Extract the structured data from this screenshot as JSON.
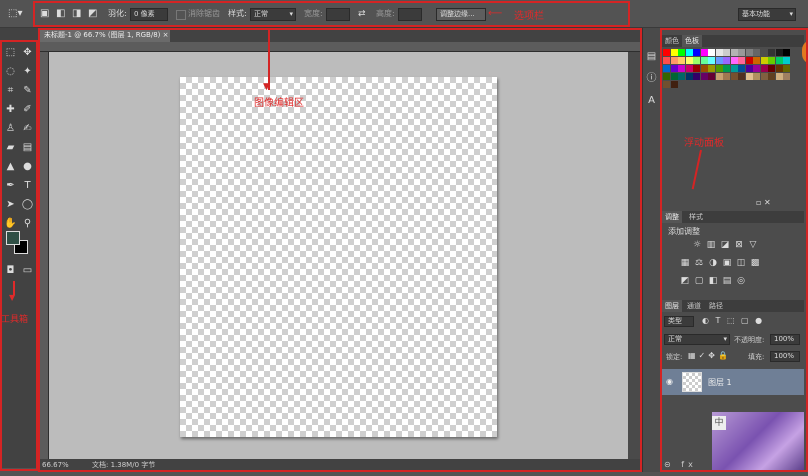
{
  "options_bar": {
    "feather_label": "羽化:",
    "feather_value": "0 像素",
    "antialias_label": "消除锯齿",
    "style_label": "样式:",
    "style_value": "正常",
    "width_label": "宽度:",
    "height_label": "高度:",
    "refine_edge_label": "调整边缘...",
    "workspace_value": "基本功能"
  },
  "document": {
    "tab_title": "未标题-1 @ 66.7% (图层 1, RGB/8) ×",
    "zoom": "66.67%",
    "doc_info": "文档: 1.38M/0 字节"
  },
  "annotations": {
    "canvas": "图像编辑区",
    "options": "选项栏",
    "panels": "浮动面板",
    "tools": "工具箱"
  },
  "swatches_panel": {
    "tabs": [
      "颜色",
      "色板"
    ],
    "colors": [
      "#ff0000",
      "#ffff00",
      "#00ff00",
      "#00ffff",
      "#0000ff",
      "#ff00ff",
      "#ffffff",
      "#e6e6e6",
      "#cccccc",
      "#b3b3b3",
      "#999999",
      "#808080",
      "#666666",
      "#4d4d4d",
      "#333333",
      "#1a1a1a",
      "#000000",
      "#ff4d4d",
      "#ff9966",
      "#ffcc66",
      "#ffff66",
      "#99ff66",
      "#66ff99",
      "#66ffff",
      "#6699ff",
      "#9966ff",
      "#ff66ff",
      "#ff6699",
      "#cc0000",
      "#cc6600",
      "#cccc00",
      "#66cc00",
      "#00cc66",
      "#00cccc",
      "#0066cc",
      "#6600cc",
      "#cc00cc",
      "#cc0066",
      "#990000",
      "#994d00",
      "#999900",
      "#4d9900",
      "#00994d",
      "#009999",
      "#004d99",
      "#4d0099",
      "#990099",
      "#99004d",
      "#660000",
      "#663300",
      "#666600",
      "#336600",
      "#006633",
      "#006666",
      "#003366",
      "#330066",
      "#660066",
      "#660033",
      "#c8a070",
      "#a07850",
      "#785030",
      "#503020",
      "#e0c090",
      "#b09060",
      "#806040",
      "#604020",
      "#d0b080",
      "#a08060",
      "#705030",
      "#402010"
    ]
  },
  "adjustments_panel": {
    "tabs": [
      "调整",
      "样式"
    ],
    "title": "添加调整",
    "icons": [
      "brightness-icon",
      "levels-icon",
      "curves-icon",
      "exposure-icon",
      "triangle-icon",
      "hsl-icon",
      "color-balance-icon",
      "bw-icon",
      "photo-filter-icon",
      "channel-mixer-icon",
      "lookup-icon",
      "invert-icon",
      "posterize-icon",
      "threshold-icon",
      "gradient-map-icon",
      "selective-color-icon"
    ]
  },
  "layers_panel": {
    "tabs": [
      "图层",
      "通道",
      "路径"
    ],
    "kind_value": "类型",
    "blend_mode": "正常",
    "opacity_label": "不透明度:",
    "opacity_value": "100%",
    "lock_label": "锁定:",
    "fill_label": "填充:",
    "fill_value": "100%",
    "layer_name": "图层 1"
  }
}
